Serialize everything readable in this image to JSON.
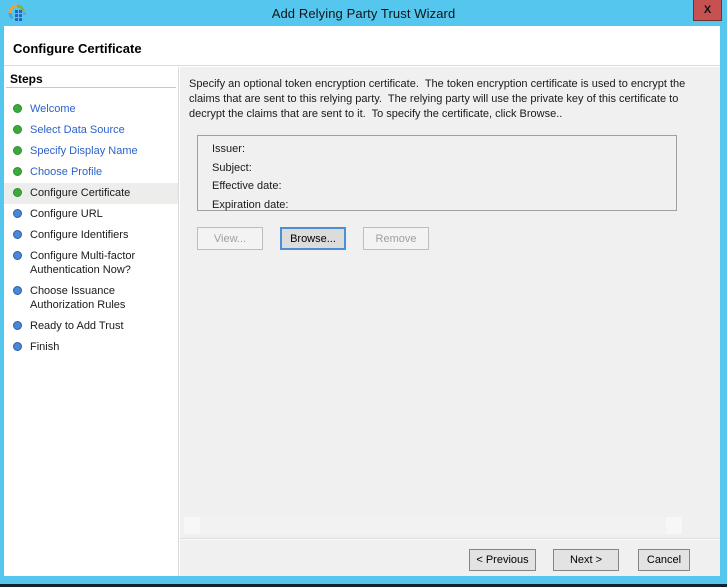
{
  "window": {
    "title": "Add Relying Party Trust Wizard",
    "close_label": "X"
  },
  "page": {
    "title": "Configure Certificate"
  },
  "sidebar": {
    "title": "Steps",
    "steps": [
      {
        "label": "Welcome",
        "state": "completed"
      },
      {
        "label": "Select Data Source",
        "state": "completed"
      },
      {
        "label": "Specify Display Name",
        "state": "completed"
      },
      {
        "label": "Choose Profile",
        "state": "completed"
      },
      {
        "label": "Configure Certificate",
        "state": "current"
      },
      {
        "label": "Configure URL",
        "state": "upcoming"
      },
      {
        "label": "Configure Identifiers",
        "state": "upcoming"
      },
      {
        "label": "Configure Multi-factor Authentication Now?",
        "state": "upcoming"
      },
      {
        "label": "Choose Issuance Authorization Rules",
        "state": "upcoming"
      },
      {
        "label": "Ready to Add Trust",
        "state": "upcoming"
      },
      {
        "label": "Finish",
        "state": "upcoming"
      }
    ]
  },
  "content": {
    "description": "Specify an optional token encryption certificate.  The token encryption certificate is used to encrypt the claims that are sent to this relying party.  The relying party will use the private key of this certificate to decrypt the claims that are sent to it.  To specify the certificate, click Browse..",
    "certificate_fields": [
      {
        "label": "Issuer:",
        "value": ""
      },
      {
        "label": "Subject:",
        "value": ""
      },
      {
        "label": "Effective date:",
        "value": ""
      },
      {
        "label": "Expiration date:",
        "value": ""
      }
    ],
    "buttons": {
      "view": "View...",
      "browse": "Browse...",
      "remove": "Remove"
    }
  },
  "footer": {
    "previous": "< Previous",
    "next": "Next >",
    "cancel": "Cancel"
  },
  "colors": {
    "titlebar_blue": "#55C7EE",
    "close_red": "#C75050",
    "focus_border_blue": "#4B8FD4",
    "step_link_blue": "#2C62C8",
    "dot_green": "#3BAA3B",
    "dot_blue": "#4C86D4",
    "content_gray": "#F0F0F0",
    "bottom_edge_dark": "#13222E"
  }
}
